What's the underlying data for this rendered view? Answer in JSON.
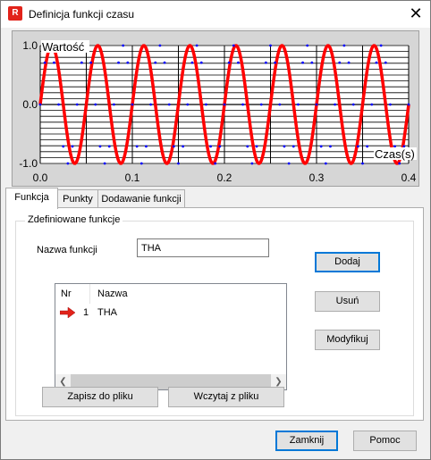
{
  "window": {
    "title": "Definicja funkcji czasu",
    "icon_letter": "R",
    "close_glyph": "✕"
  },
  "chart_data": {
    "type": "line",
    "ylabel": "Wartość",
    "xlabel": "Czas(s)",
    "xlim": [
      0.0,
      0.4
    ],
    "ylim": [
      -1.0,
      1.0
    ],
    "x_ticks": [
      "0.0",
      "0.1",
      "0.2",
      "0.3",
      "0.4"
    ],
    "y_ticks": [
      "1.0",
      "0.0",
      "-1.0"
    ],
    "grid": true,
    "colors": {
      "background": "#d6d6d6",
      "plot": "#ffffff",
      "grid": "#000000",
      "curve": "#ff0000",
      "points": "#0000ff"
    },
    "series": [
      {
        "x": [
          0.0,
          0.005,
          0.01,
          0.015,
          0.02,
          0.025,
          0.03,
          0.035,
          0.04,
          0.045,
          0.05,
          0.055,
          0.06,
          0.065,
          0.07,
          0.075,
          0.08,
          0.085,
          0.09,
          0.095,
          0.1,
          0.105,
          0.11,
          0.115,
          0.12,
          0.125,
          0.13,
          0.135,
          0.14,
          0.145,
          0.15,
          0.155,
          0.16,
          0.165,
          0.17,
          0.175,
          0.18,
          0.185,
          0.19,
          0.195,
          0.2,
          0.205,
          0.21,
          0.215,
          0.22,
          0.225,
          0.23,
          0.235,
          0.24,
          0.245,
          0.25,
          0.255,
          0.26,
          0.265,
          0.27,
          0.275,
          0.28,
          0.285,
          0.29,
          0.295,
          0.3,
          0.305,
          0.31,
          0.315,
          0.32,
          0.325,
          0.33,
          0.335,
          0.34,
          0.345,
          0.35,
          0.355,
          0.36,
          0.365,
          0.37,
          0.375,
          0.38,
          0.385,
          0.39,
          0.395,
          0.4
        ],
        "y": [
          0.0,
          0.71,
          1.0,
          0.71,
          0.0,
          -0.71,
          -1.0,
          -0.71,
          0.0,
          0.71,
          1.0,
          0.71,
          0.0,
          -0.71,
          -1.0,
          -0.71,
          0.0,
          0.71,
          1.0,
          0.71,
          0.0,
          -0.71,
          -1.0,
          -0.71,
          0.0,
          0.71,
          1.0,
          0.71,
          0.0,
          -0.71,
          -1.0,
          -0.71,
          0.0,
          0.71,
          1.0,
          0.71,
          0.0,
          -0.71,
          -1.0,
          -0.71,
          0.0,
          0.71,
          1.0,
          0.71,
          0.0,
          -0.71,
          -1.0,
          -0.71,
          0.0,
          0.71,
          1.0,
          0.71,
          0.0,
          -0.71,
          -1.0,
          -0.71,
          0.0,
          0.71,
          1.0,
          0.71,
          0.0,
          -0.71,
          -1.0,
          -0.71,
          0.0,
          0.71,
          1.0,
          0.71,
          0.0,
          -0.71,
          -1.0,
          -0.71,
          0.0,
          0.71,
          1.0,
          0.71,
          0.0,
          -0.71,
          -1.0,
          -0.71,
          0.0
        ]
      }
    ]
  },
  "tabs": [
    {
      "label": "Funkcja",
      "active": true
    },
    {
      "label": "Punkty",
      "active": false
    },
    {
      "label": "Dodawanie funkcji",
      "active": false
    }
  ],
  "panel": {
    "group_label": "Zdefiniowane funkcje",
    "name_label": "Nazwa funkcji",
    "name_value": "THA",
    "list_headers": [
      "Nr",
      "Nazwa"
    ],
    "rows": [
      {
        "nr": "1",
        "name": "THA"
      }
    ],
    "save_button": "Zapisz do pliku",
    "load_button": "Wczytaj z pliku",
    "add_button": "Dodaj",
    "remove_button": "Usuń",
    "modify_button": "Modyfikuj"
  },
  "footer": {
    "close_button": "Zamknij",
    "help_button": "Pomoc"
  }
}
